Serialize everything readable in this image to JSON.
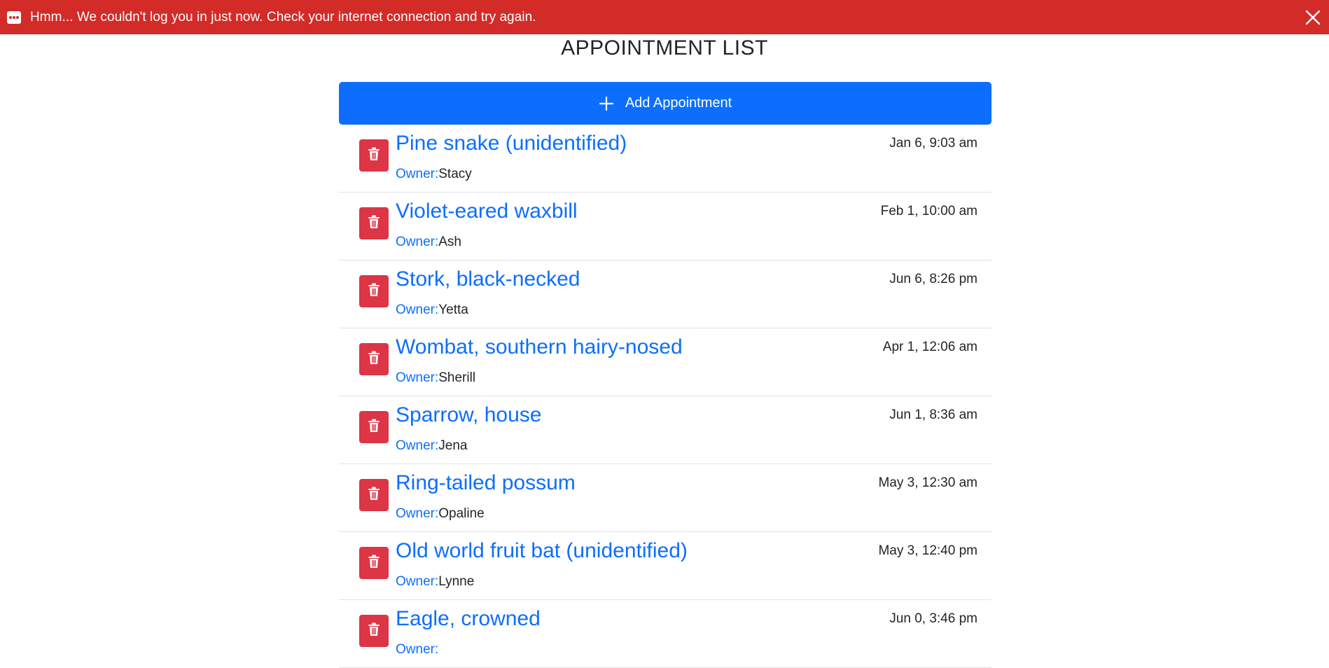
{
  "banner": {
    "message": "Hmm... We couldn't log you in just now. Check your internet connection and try again."
  },
  "page": {
    "title": "APPOINTMENT LIST"
  },
  "toolbar": {
    "add_label": "Add Appointment"
  },
  "owner_prefix": "Owner:",
  "appointments": [
    {
      "pet": "Pine snake (unidentified)",
      "owner": "Stacy",
      "date": "Jan 6, 9:03 am"
    },
    {
      "pet": "Violet-eared waxbill",
      "owner": "Ash",
      "date": "Feb 1, 10:00 am"
    },
    {
      "pet": "Stork, black-necked",
      "owner": "Yetta",
      "date": "Jun 6, 8:26 pm"
    },
    {
      "pet": "Wombat, southern hairy-nosed",
      "owner": "Sherill",
      "date": "Apr 1, 12:06 am"
    },
    {
      "pet": "Sparrow, house",
      "owner": "Jena",
      "date": "Jun 1, 8:36 am"
    },
    {
      "pet": "Ring-tailed possum",
      "owner": "Opaline",
      "date": "May 3, 12:30 am"
    },
    {
      "pet": "Old world fruit bat (unidentified)",
      "owner": "Lynne",
      "date": "May 3, 12:40 pm"
    },
    {
      "pet": "Eagle, crowned",
      "owner": "",
      "date": "Jun 0, 3:46 pm"
    }
  ],
  "colors": {
    "banner": "#d32b28",
    "primary": "#0d6efd",
    "danger": "#dc3545"
  },
  "icons": {
    "banner": "message-dots-icon",
    "close": "close-icon",
    "add": "plus-icon",
    "delete": "trash-icon"
  }
}
